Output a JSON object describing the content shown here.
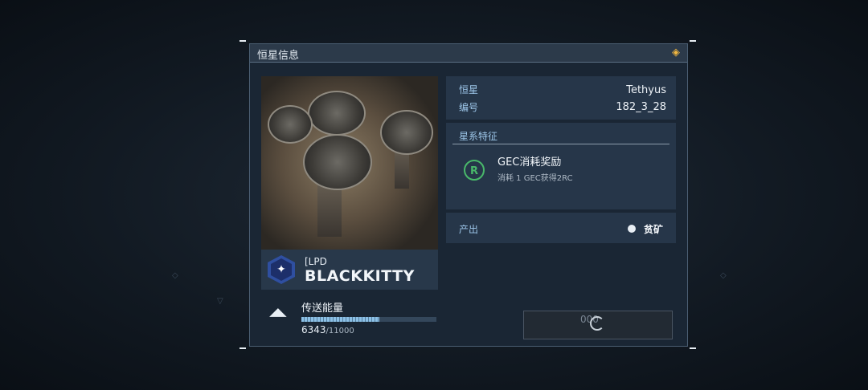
{
  "dialog": {
    "title": "恒星信息"
  },
  "owner": {
    "tag": "[LPD",
    "name": "BLACKKITTY"
  },
  "energy": {
    "label": "传送能量",
    "value": "6343",
    "max": "/11000",
    "fraction": 0.577
  },
  "star": {
    "star_label": "恒星",
    "star_value": "Tethyus",
    "id_label": "编号",
    "id_value": "182_3_28"
  },
  "features": {
    "header": "星系特征",
    "gec_title": "GEC消耗奖励",
    "gec_desc": "消耗 1 GEC获得2RC"
  },
  "output": {
    "label": "产出",
    "value": "贫矿"
  },
  "action": {
    "cost": "000"
  },
  "icons": {
    "close": "diamond-close-icon",
    "gec": "gec-reward-icon",
    "energy": "teleport-energy-icon",
    "emblem": "alliance-emblem-icon",
    "ore": "ore-icon",
    "loading": "loading-spinner-icon"
  },
  "colors": {
    "accent": "#9ec7ea",
    "close": "#f0b640",
    "gec": "#49b86a"
  }
}
